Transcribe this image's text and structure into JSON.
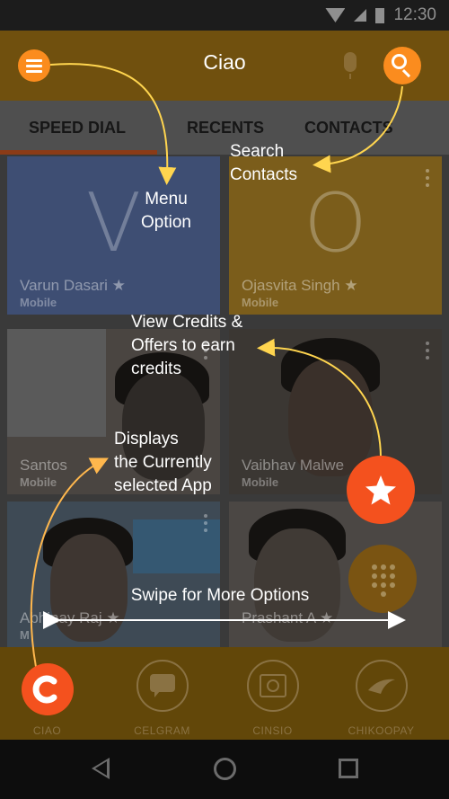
{
  "status": {
    "time": "12:30",
    "icons": [
      "wifi-icon",
      "signal-icon",
      "battery-icon"
    ]
  },
  "app_bar": {
    "title": "Ciao",
    "left_icon": "menu-icon",
    "right_icons": [
      "mic-icon",
      "search-icon"
    ]
  },
  "tabs": [
    {
      "label": "SPEED DIAL",
      "selected": true
    },
    {
      "label": "RECENTS",
      "selected": false
    },
    {
      "label": "CONTACTS",
      "selected": false
    }
  ],
  "contacts": [
    {
      "initial": "V",
      "name": "Varun Dasari ★",
      "type": "Mobile",
      "color": "#3e4e73"
    },
    {
      "initial": "O",
      "name": "Ojasvita Singh ★",
      "type": "Mobile",
      "color": "#7b5d1b"
    },
    {
      "name": "Santos",
      "type": "Mobile"
    },
    {
      "name": "Vaibhav Malwe",
      "type": "Mobile"
    },
    {
      "name": "Abhinay Raj ★",
      "type": "M"
    },
    {
      "name": "Prashant A ★",
      "type": ""
    }
  ],
  "bottom_apps": [
    {
      "label": "CIAO",
      "icon": "ciao-icon",
      "active": true
    },
    {
      "label": "CELGRAM",
      "icon": "chat-bubble-icon",
      "active": false
    },
    {
      "label": "CINSIO",
      "icon": "camera-icon",
      "active": false
    },
    {
      "label": "CHIKOOPAY",
      "icon": "wing-icon",
      "active": false
    }
  ],
  "nav": [
    "back-icon",
    "home-icon",
    "recents-icon"
  ],
  "tips": {
    "menu": [
      "Menu",
      "Option"
    ],
    "search": [
      "Search",
      "Contacts"
    ],
    "credits": [
      "View Credits &",
      "Offers to earn",
      "credits"
    ],
    "app": [
      "Displays",
      "the Currently",
      "selected App"
    ],
    "swipe": "Swipe for More Options"
  },
  "colors": {
    "accent": "#fb8c1e",
    "highlight": "#f4511e",
    "arrow": "#ffd54f",
    "app_bar": "#70500e"
  }
}
